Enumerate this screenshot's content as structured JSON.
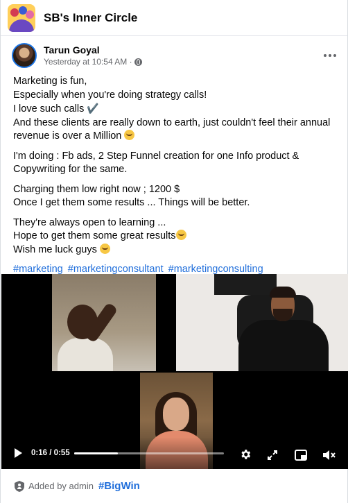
{
  "group": {
    "name": "SB's Inner Circle"
  },
  "post": {
    "author": "Tarun Goyal",
    "time": "Yesterday at 10:54 AM ·",
    "privacy_icon": "globe-icon",
    "menu_icon": "more-icon",
    "paragraphs": {
      "p1": {
        "l1": "Marketing is fun,",
        "l2": "Especially when you're doing strategy calls!",
        "l3": "I love such calls",
        "l3_emoji": "✔️",
        "l4": "And these clients are really down to earth, just couldn't feel their annual revenue is over a Million"
      },
      "p2": {
        "l1": "I'm doing : Fb ads,  2 Step Funnel creation for one Info product & Copywriting for the same."
      },
      "p3": {
        "l1": "Charging them low right now ; 1200 $",
        "l2": "Once I get them some results ... Things will be better."
      },
      "p4": {
        "l1": "They're always open to learning ...",
        "l2": "Hope to get them some great results",
        "l3": "Wish me luck guys"
      }
    },
    "hashtags": [
      "#marketing",
      "#marketingconsultant",
      "#marketingconsulting"
    ]
  },
  "video": {
    "current_time": "0:16",
    "duration": "0:55",
    "time_display": "0:16 / 0:55",
    "progress_fraction": 0.29,
    "icons": [
      "play-icon",
      "gear-icon",
      "expand-icon",
      "pip-icon",
      "volume-icon"
    ]
  },
  "footer": {
    "added_by": "Added by admin",
    "tag": "#BigWin"
  },
  "colors": {
    "link": "#216fdb",
    "secondary_text": "#65676b",
    "accent_border": "#1b74e4"
  }
}
